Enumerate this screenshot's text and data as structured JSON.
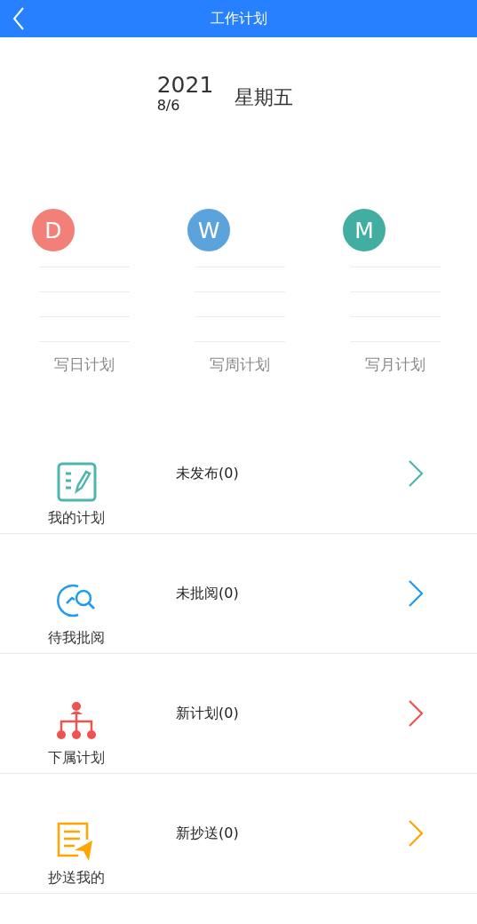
{
  "header": {
    "title": "工作计划"
  },
  "date": {
    "year": "2021",
    "month_day": "8/6",
    "weekday": "星期五"
  },
  "plan_types": [
    {
      "letter": "D",
      "color": "#f27f78",
      "label": "写日计划"
    },
    {
      "letter": "W",
      "color": "#5ba3dc",
      "label": "写周计划"
    },
    {
      "letter": "M",
      "color": "#42ada1",
      "label": "写月计划"
    }
  ],
  "sections": [
    {
      "kind": "notepad",
      "label": "我的计划",
      "status": "未发布(0)",
      "color": "#4db6ac"
    },
    {
      "kind": "review",
      "label": "待我批阅",
      "status": "未批阅(0)",
      "color": "#1e9bf0"
    },
    {
      "kind": "hierarchy",
      "label": "下属计划",
      "status": "新计划(0)",
      "color": "#ef5350"
    },
    {
      "kind": "send",
      "label": "抄送我的",
      "status": "新抄送(0)",
      "color": "#ffa500"
    }
  ]
}
